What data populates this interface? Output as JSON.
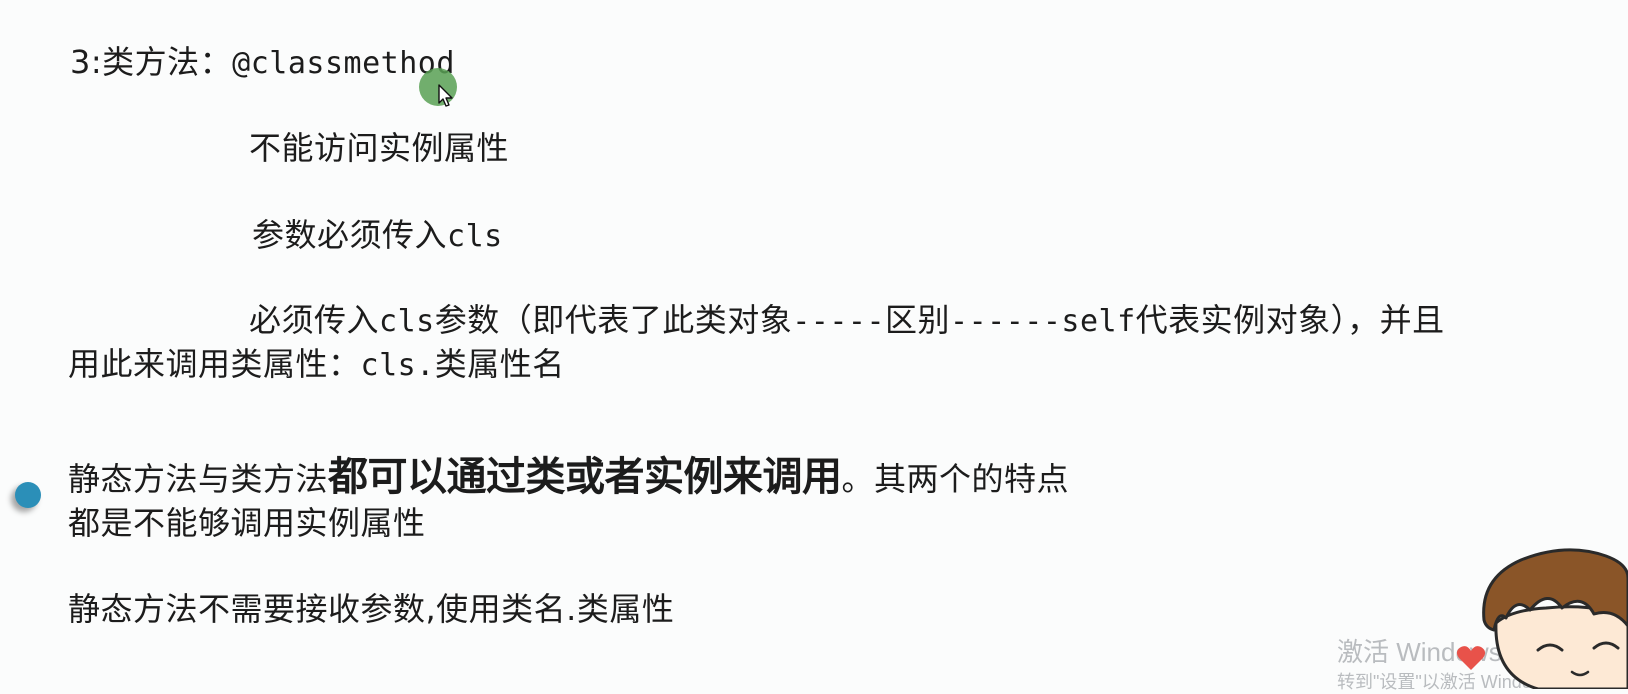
{
  "notes": {
    "heading_prefix": "3:类方法：",
    "heading_code": "@classmethod",
    "line1": "不能访问实例属性",
    "line2_text": "参数必须传入",
    "line2_code": "cls",
    "line3_a": "必须传入",
    "line3_code1": "cls",
    "line3_b": "参数（即代表了此类对象",
    "line3_dash1": "-----",
    "line3_c": "区别",
    "line3_dash2": "------",
    "line3_code2": "self",
    "line3_d": "代表实例对象），并且",
    "line4_a": "用此来调用类属性：",
    "line4_code": "cls.",
    "line4_b": "类属性名"
  },
  "bullet_item": {
    "part1": "静态方法与类方法",
    "emphasis": "都可以通过类或者实例来调用",
    "part2": "。其两个的特点",
    "line2": "都是不能够调用实例属性"
  },
  "static_note": "静态方法不需要接收参数,使用类名.类属性",
  "watermark": {
    "title": "激活 Windows",
    "subtitle": "转到\"设置\"以激活 Windows。"
  },
  "colors": {
    "background": "#fbfcfc",
    "text": "#1c1c1c",
    "bullet": "#2b8fb8",
    "cursor_highlight": "#58a054",
    "watermark": "#b9bcbf"
  },
  "icons": [
    "mouse-cursor-icon",
    "bullet-dot-icon",
    "cartoon-avatar-icon",
    "heart-icon"
  ]
}
